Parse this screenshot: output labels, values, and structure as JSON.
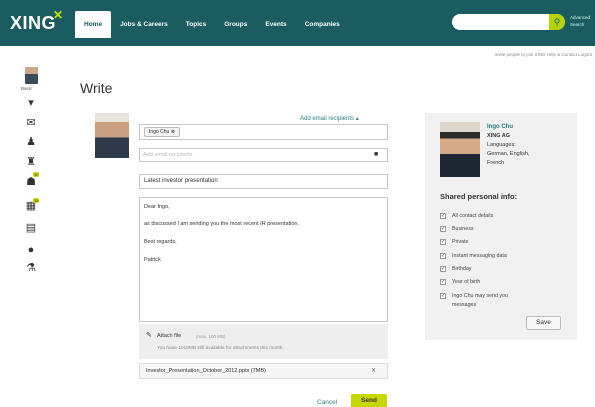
{
  "header": {
    "logo": "XING",
    "nav": [
      "Home",
      "Jobs & Careers",
      "Topics",
      "Groups",
      "Events",
      "Companies"
    ],
    "advanced_search": "Advanced Search"
  },
  "util_links": "Invite people to join XING   Help & Contact   Logout",
  "sidebar": {
    "profile_label": "Basic",
    "badges": [
      "10",
      "15"
    ]
  },
  "main": {
    "title": "Write",
    "add_recipients": "Add email recipients ▴",
    "recipient_tag": "Ingo Chu",
    "email_placeholder": "Add email recipients",
    "subject": "Latest investor presentation",
    "message_lines": [
      "Dear Ingo,",
      "as discussed I am sending you the most recent IR presentation.",
      "Best regards,",
      "Patrick"
    ],
    "attach_label": "Attach file",
    "attach_hint": "(max. 100 MB)",
    "attach_info": "You have 1018MB still available for attachments this month.",
    "file_name": "Investor_Presentation_October_2012.pptx (7MB)",
    "cancel": "Cancel",
    "send": "Send"
  },
  "contact": {
    "name": "Ingo Chu",
    "company": "XING AG",
    "languages_label": "Languages:",
    "languages": "German, English,",
    "languages2": "French",
    "shared_title": "Shared personal info:",
    "items": [
      "All contact details",
      "Business",
      "Private",
      "Instant messaging data",
      "Birthday",
      "Year of birth",
      "Ingo Chu may send you",
      "messages"
    ],
    "save": "Save"
  }
}
